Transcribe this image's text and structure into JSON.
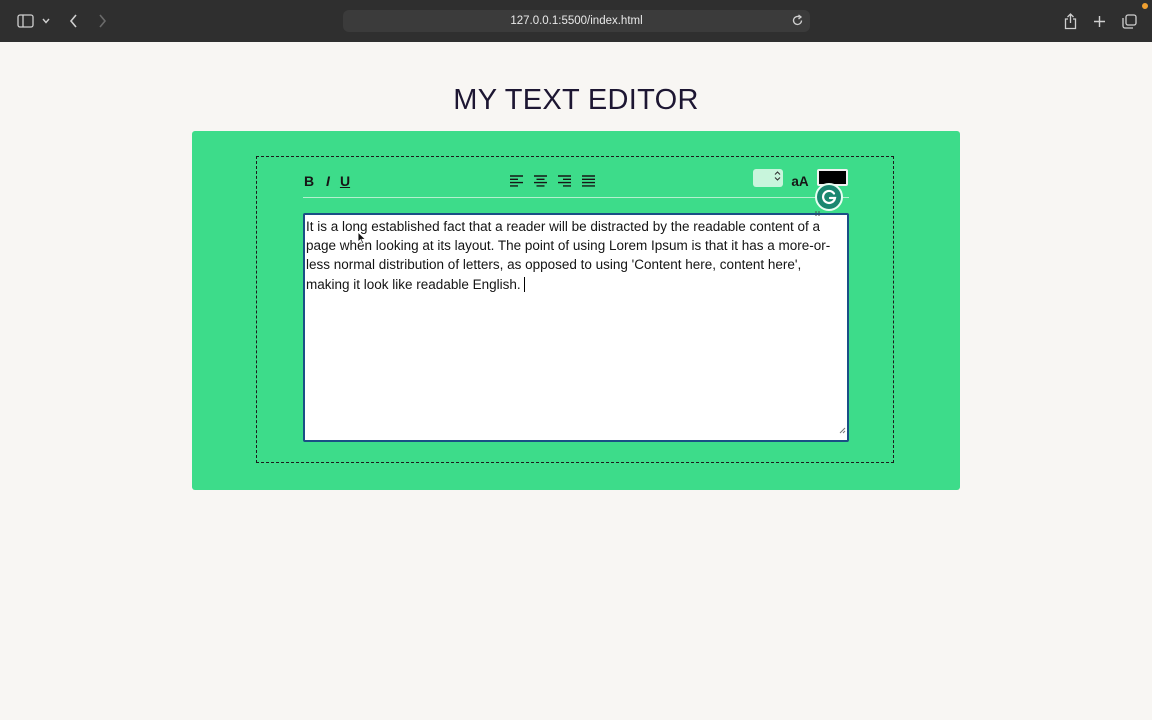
{
  "browser": {
    "url": "127.0.0.1:5500/index.html",
    "icons": {
      "sidebar": "sidebar-icon",
      "chevron": "chevron-down-icon",
      "back": "back-icon",
      "forward": "forward-icon",
      "reload": "reload-icon",
      "share": "share-icon",
      "new_tab": "plus-icon",
      "tabs": "tabs-overview-icon"
    }
  },
  "page": {
    "title": "MY TEXT EDITOR"
  },
  "toolbar": {
    "bold_label": "B",
    "italic_label": "I",
    "underline_label": "U",
    "font_case_label": "aA",
    "font_size_value": "",
    "text_color": "#000000",
    "align_icons": [
      "align-left-icon",
      "align-center-icon",
      "align-right-icon",
      "align-justify-icon"
    ]
  },
  "editor": {
    "content": "It is a long established fact that a reader will be distracted by the readable content of a page when looking at its layout. The point of using Lorem Ipsum is that it has a more-or-less normal distribution of letters, as opposed to using 'Content here, content here', making it look like readable English."
  },
  "colors": {
    "panel": "#3ddc8a",
    "title": "#1d1632",
    "textarea_border": "#1a4f85"
  }
}
